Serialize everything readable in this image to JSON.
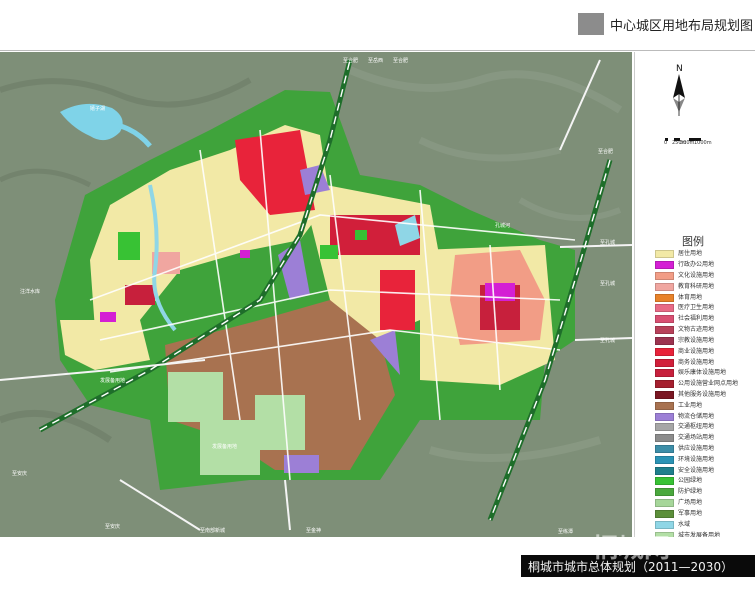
{
  "header": {
    "title": "中心城区用地布局规划图"
  },
  "north_arrow": {
    "letter": "N"
  },
  "scale_bar": {
    "labels": [
      "0",
      "250m",
      "500m",
      "1000m"
    ]
  },
  "legend": {
    "title": "图例",
    "items": [
      {
        "label": "居住用地",
        "color": "#f2e9a6"
      },
      {
        "label": "行政办公用地",
        "color": "#d41fd4"
      },
      {
        "label": "文化设施用地",
        "color": "#f29d86"
      },
      {
        "label": "教育科研用地",
        "color": "#f0a6a0"
      },
      {
        "label": "体育用地",
        "color": "#e8822a"
      },
      {
        "label": "医疗卫生用地",
        "color": "#e86a86"
      },
      {
        "label": "社会福利用地",
        "color": "#d94f72"
      },
      {
        "label": "文物古迹用地",
        "color": "#b8415a"
      },
      {
        "label": "宗教设施用地",
        "color": "#9c3350"
      },
      {
        "label": "商业设施用地",
        "color": "#e8233a"
      },
      {
        "label": "商务设施用地",
        "color": "#d11f3a"
      },
      {
        "label": "娱乐康体设施用地",
        "color": "#c7203c"
      },
      {
        "label": "公用设施营业网点用地",
        "color": "#a51f2e"
      },
      {
        "label": "其他服务设施用地",
        "color": "#7a1622"
      },
      {
        "label": "工业用地",
        "color": "#a87250"
      },
      {
        "label": "物流仓储用地",
        "color": "#9c7fd6"
      },
      {
        "label": "交通枢纽用地",
        "color": "#a6a6a6"
      },
      {
        "label": "交通场站用地",
        "color": "#8c8c8c"
      },
      {
        "label": "供应设施用地",
        "color": "#3d8ea8"
      },
      {
        "label": "环境设施用地",
        "color": "#2b93b5"
      },
      {
        "label": "安全设施用地",
        "color": "#1f7f8c"
      },
      {
        "label": "公园绿地",
        "color": "#38c234"
      },
      {
        "label": "防护绿地",
        "color": "#4aa83d"
      },
      {
        "label": "广场用地",
        "color": "#a6d69a"
      },
      {
        "label": "军事用地",
        "color": "#5c8f3a"
      },
      {
        "label": "水域",
        "color": "#8fd6e6"
      },
      {
        "label": "城市发展备用地",
        "color": "#b3dfa6"
      },
      {
        "label": "农林用地",
        "color": "#ccebc2"
      }
    ]
  },
  "map": {
    "place_labels": [
      "至合肥",
      "至岳西",
      "至合肥",
      "至合肥",
      "孔城河",
      "至孔城",
      "至孔城",
      "至孔城",
      "发展备用地",
      "发展备用地",
      "至安庆",
      "至安庆",
      "至金神",
      "至南部新城",
      "至练潭",
      "注洋水库",
      "嬉子湖"
    ]
  },
  "footer": {
    "caption": "桐城市城市总体规划（2011—2030）",
    "watermark": "桐城网"
  }
}
